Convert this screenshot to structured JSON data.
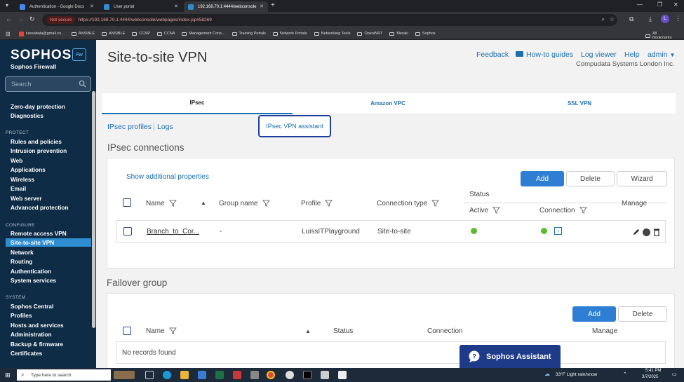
{
  "browser": {
    "tabs": [
      {
        "title": "Authentication - Google Docs",
        "color": "#4285f4"
      },
      {
        "title": "User portal",
        "color": "#2f8dd1"
      },
      {
        "title": "192.168.70.1:4444/webconsole",
        "color": "#2f8dd1"
      }
    ],
    "security_label": "Not secure",
    "url": "https://192.168.70.1:4444/webconsole/webpages/index.jsp#58269",
    "bookmarks": [
      "luissabala@gmail.co...",
      "ANSIBLE",
      "ANSIBLE",
      "CCNP",
      "CCNA",
      "Management Cons...",
      "Training Portals",
      "Network Portals",
      "Networking Tools",
      "OpenWRT",
      "Meraki",
      "Sophos"
    ],
    "all_bookmarks": "All Bookmarks",
    "profile_initial": "L"
  },
  "sidebar": {
    "logo": "SOPHOS",
    "logo_badge": "Fw",
    "subtitle": "Sophos Firewall",
    "search_placeholder": "Search",
    "monitor_items": [
      "Zero-day protection",
      "Diagnostics"
    ],
    "protect_heading": "PROTECT",
    "protect_items": [
      "Rules and policies",
      "Intrusion prevention",
      "Web",
      "Applications",
      "Wireless",
      "Email",
      "Web server",
      "Advanced protection"
    ],
    "configure_heading": "CONFIGURE",
    "configure_items": [
      "Remote access VPN",
      "Site-to-site VPN",
      "Network",
      "Routing",
      "Authentication",
      "System services"
    ],
    "system_heading": "SYSTEM",
    "system_items": [
      "Sophos Central",
      "Profiles",
      "Hosts and services",
      "Administration",
      "Backup & firmware",
      "Certificates"
    ],
    "active_item": "Site-to-site VPN"
  },
  "header": {
    "title": "Site-to-site VPN",
    "links": [
      "Feedback",
      "How-to guides",
      "Log viewer",
      "Help",
      "admin"
    ],
    "org": "Compudata Systems London Inc."
  },
  "tabs": [
    "IPsec",
    "Amazon VPC",
    "SSL VPN"
  ],
  "active_tab": "IPsec",
  "subtabs": [
    "IPsec profiles",
    "Logs"
  ],
  "assistant_button": "IPsec VPN assistant",
  "ipsec": {
    "title": "IPsec connections",
    "show_props": "Show additional properties",
    "buttons": {
      "add": "Add",
      "delete": "Delete",
      "wizard": "Wizard"
    },
    "columns": {
      "name": "Name",
      "group": "Group name",
      "profile": "Profile",
      "conn_type": "Connection type",
      "status": "Status",
      "active": "Active",
      "connection": "Connection",
      "manage": "Manage"
    },
    "rows": [
      {
        "name": "Branch_to_Cor...",
        "group": "-",
        "profile": "LuissITPlayground",
        "type": "Site-to-site",
        "active": true,
        "connection": true
      }
    ]
  },
  "failover": {
    "title": "Failover group",
    "buttons": {
      "add": "Add",
      "delete": "Delete"
    },
    "columns": {
      "name": "Name",
      "status": "Status",
      "connection": "Connection",
      "manage": "Manage"
    },
    "empty": "No records found"
  },
  "assistant_chat": "Sophos Assistant",
  "taskbar": {
    "search_placeholder": "Type here to search",
    "weather": "33°F  Light rain/snow",
    "time": "5:41 PM",
    "date": "3/7/2025"
  }
}
